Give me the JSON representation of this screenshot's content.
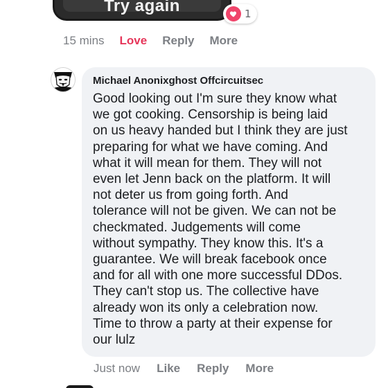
{
  "top_comment": {
    "media_caption": "Try again",
    "reaction_count": "1",
    "colors": {
      "love_accent": "#e6365a",
      "heart_badge": "#f0446a"
    },
    "actions": {
      "time": "15 mins",
      "love": "Love",
      "reply": "Reply",
      "more": "More"
    }
  },
  "comment": {
    "author": "Michael Anonixghost Offcircuitsec",
    "lines": [
      "Good looking out I'm sure they know what",
      "we got cooking. Censorship is being laid",
      "on us heavy handed but I think they are just",
      "preparing for what we have coming. And",
      "what it will mean for them. They will not",
      "even let Jenn back on the platform. It will",
      "not deter us from going forth. And",
      "tolerance will not be given. We can not be",
      "checkmated. Judgements will come",
      "without sympathy. They know this. It's a",
      "guarantee. We will break facebook once",
      "and for all with one more successful DDos.",
      "They can't stop us. The collective have",
      "already won its only a celebration now.",
      "Time to throw a party at their expense for",
      "our lulz"
    ],
    "bubble_color": "#f0f2f5",
    "actions": {
      "time": "Just now",
      "like": "Like",
      "reply": "Reply",
      "more": "More"
    }
  }
}
